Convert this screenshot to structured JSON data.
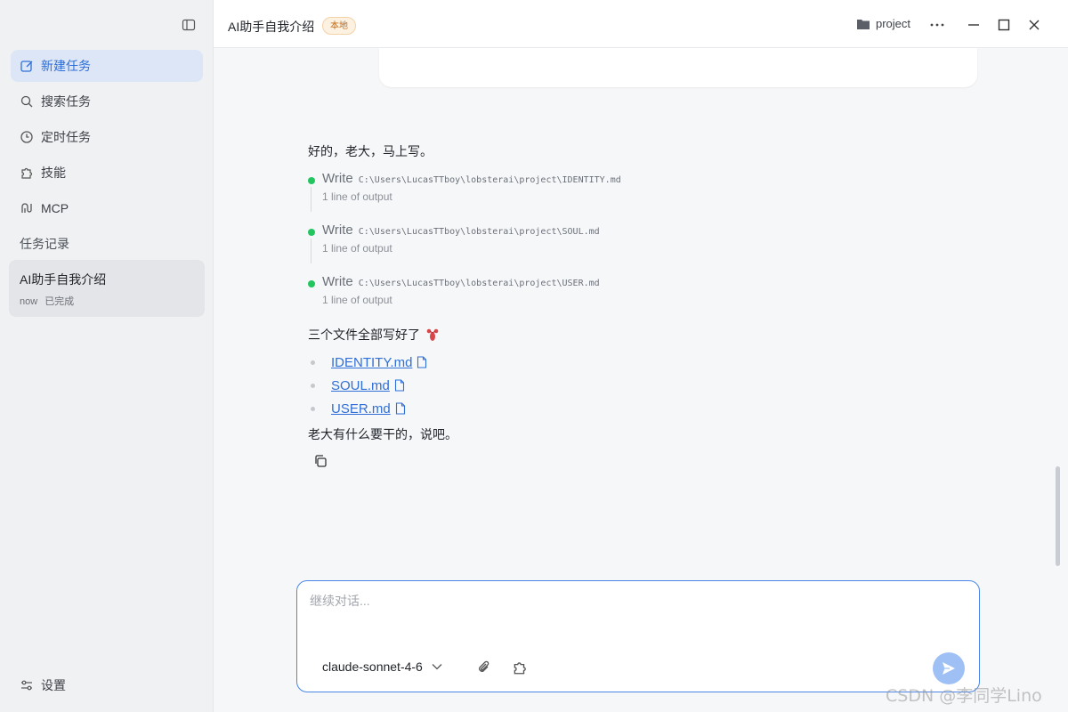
{
  "sidebar": {
    "items": [
      {
        "label": "新建任务",
        "icon": "edit-icon"
      },
      {
        "label": "搜索任务",
        "icon": "search-icon"
      },
      {
        "label": "定时任务",
        "icon": "clock-icon"
      },
      {
        "label": "技能",
        "icon": "puzzle-icon"
      },
      {
        "label": "MCP",
        "icon": "mcp-icon"
      }
    ],
    "section_label": "任务记录",
    "history": [
      {
        "title": "AI助手自我介绍",
        "time": "now",
        "status": "已完成"
      }
    ],
    "settings_label": "设置"
  },
  "header": {
    "title": "AI助手自我介绍",
    "badge": "本地",
    "folder": "project"
  },
  "chat": {
    "reply_intro": "好的，老大，马上写。",
    "tools": [
      {
        "label": "Write",
        "path": "C:\\Users\\LucasTTboy\\lobsterai\\project\\IDENTITY.md",
        "output": "1 line of output"
      },
      {
        "label": "Write",
        "path": "C:\\Users\\LucasTTboy\\lobsterai\\project\\SOUL.md",
        "output": "1 line of output"
      },
      {
        "label": "Write",
        "path": "C:\\Users\\LucasTTboy\\lobsterai\\project\\USER.md",
        "output": "1 line of output"
      }
    ],
    "done_text": "三个文件全部写好了",
    "files": [
      "IDENTITY.md",
      "SOUL.md",
      "USER.md"
    ],
    "closing": "老大有什么要干的，说吧。"
  },
  "composer": {
    "placeholder": "继续对话...",
    "value": "",
    "model": "claude-sonnet-4-6"
  },
  "watermark": "CSDN @李同学Lino",
  "colors": {
    "accent": "#2f6fd6",
    "status_dot": "#22c55e",
    "send_button": "#9ec0f5",
    "badge_text": "#c06a14"
  }
}
